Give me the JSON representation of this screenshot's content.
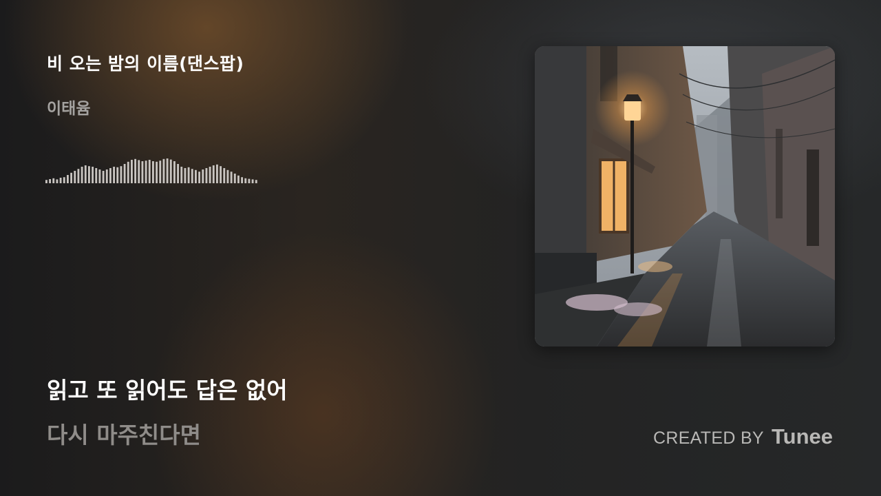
{
  "track": {
    "title": "비 오는 밤의 이름(댄스팝)",
    "artist": "이태윰"
  },
  "waveform": {
    "levels": [
      0.12,
      0.15,
      0.18,
      0.14,
      0.2,
      0.22,
      0.3,
      0.38,
      0.45,
      0.52,
      0.6,
      0.65,
      0.62,
      0.6,
      0.55,
      0.5,
      0.45,
      0.5,
      0.55,
      0.6,
      0.58,
      0.62,
      0.7,
      0.78,
      0.85,
      0.88,
      0.84,
      0.8,
      0.82,
      0.85,
      0.8,
      0.78,
      0.82,
      0.88,
      0.9,
      0.86,
      0.8,
      0.7,
      0.6,
      0.55,
      0.58,
      0.52,
      0.48,
      0.42,
      0.5,
      0.55,
      0.6,
      0.65,
      0.68,
      0.62,
      0.55,
      0.48,
      0.42,
      0.35,
      0.28,
      0.22,
      0.18,
      0.16,
      0.14,
      0.12
    ],
    "color": "#c9c5c1"
  },
  "lyrics": {
    "current": "읽고 또 읽어도 답은 없어",
    "next": "다시 마주친다면"
  },
  "credit": {
    "prefix": "CREATED BY",
    "brand": "Tunee"
  },
  "cover_art": {
    "icon": "rainy-alley-lamp-image"
  }
}
